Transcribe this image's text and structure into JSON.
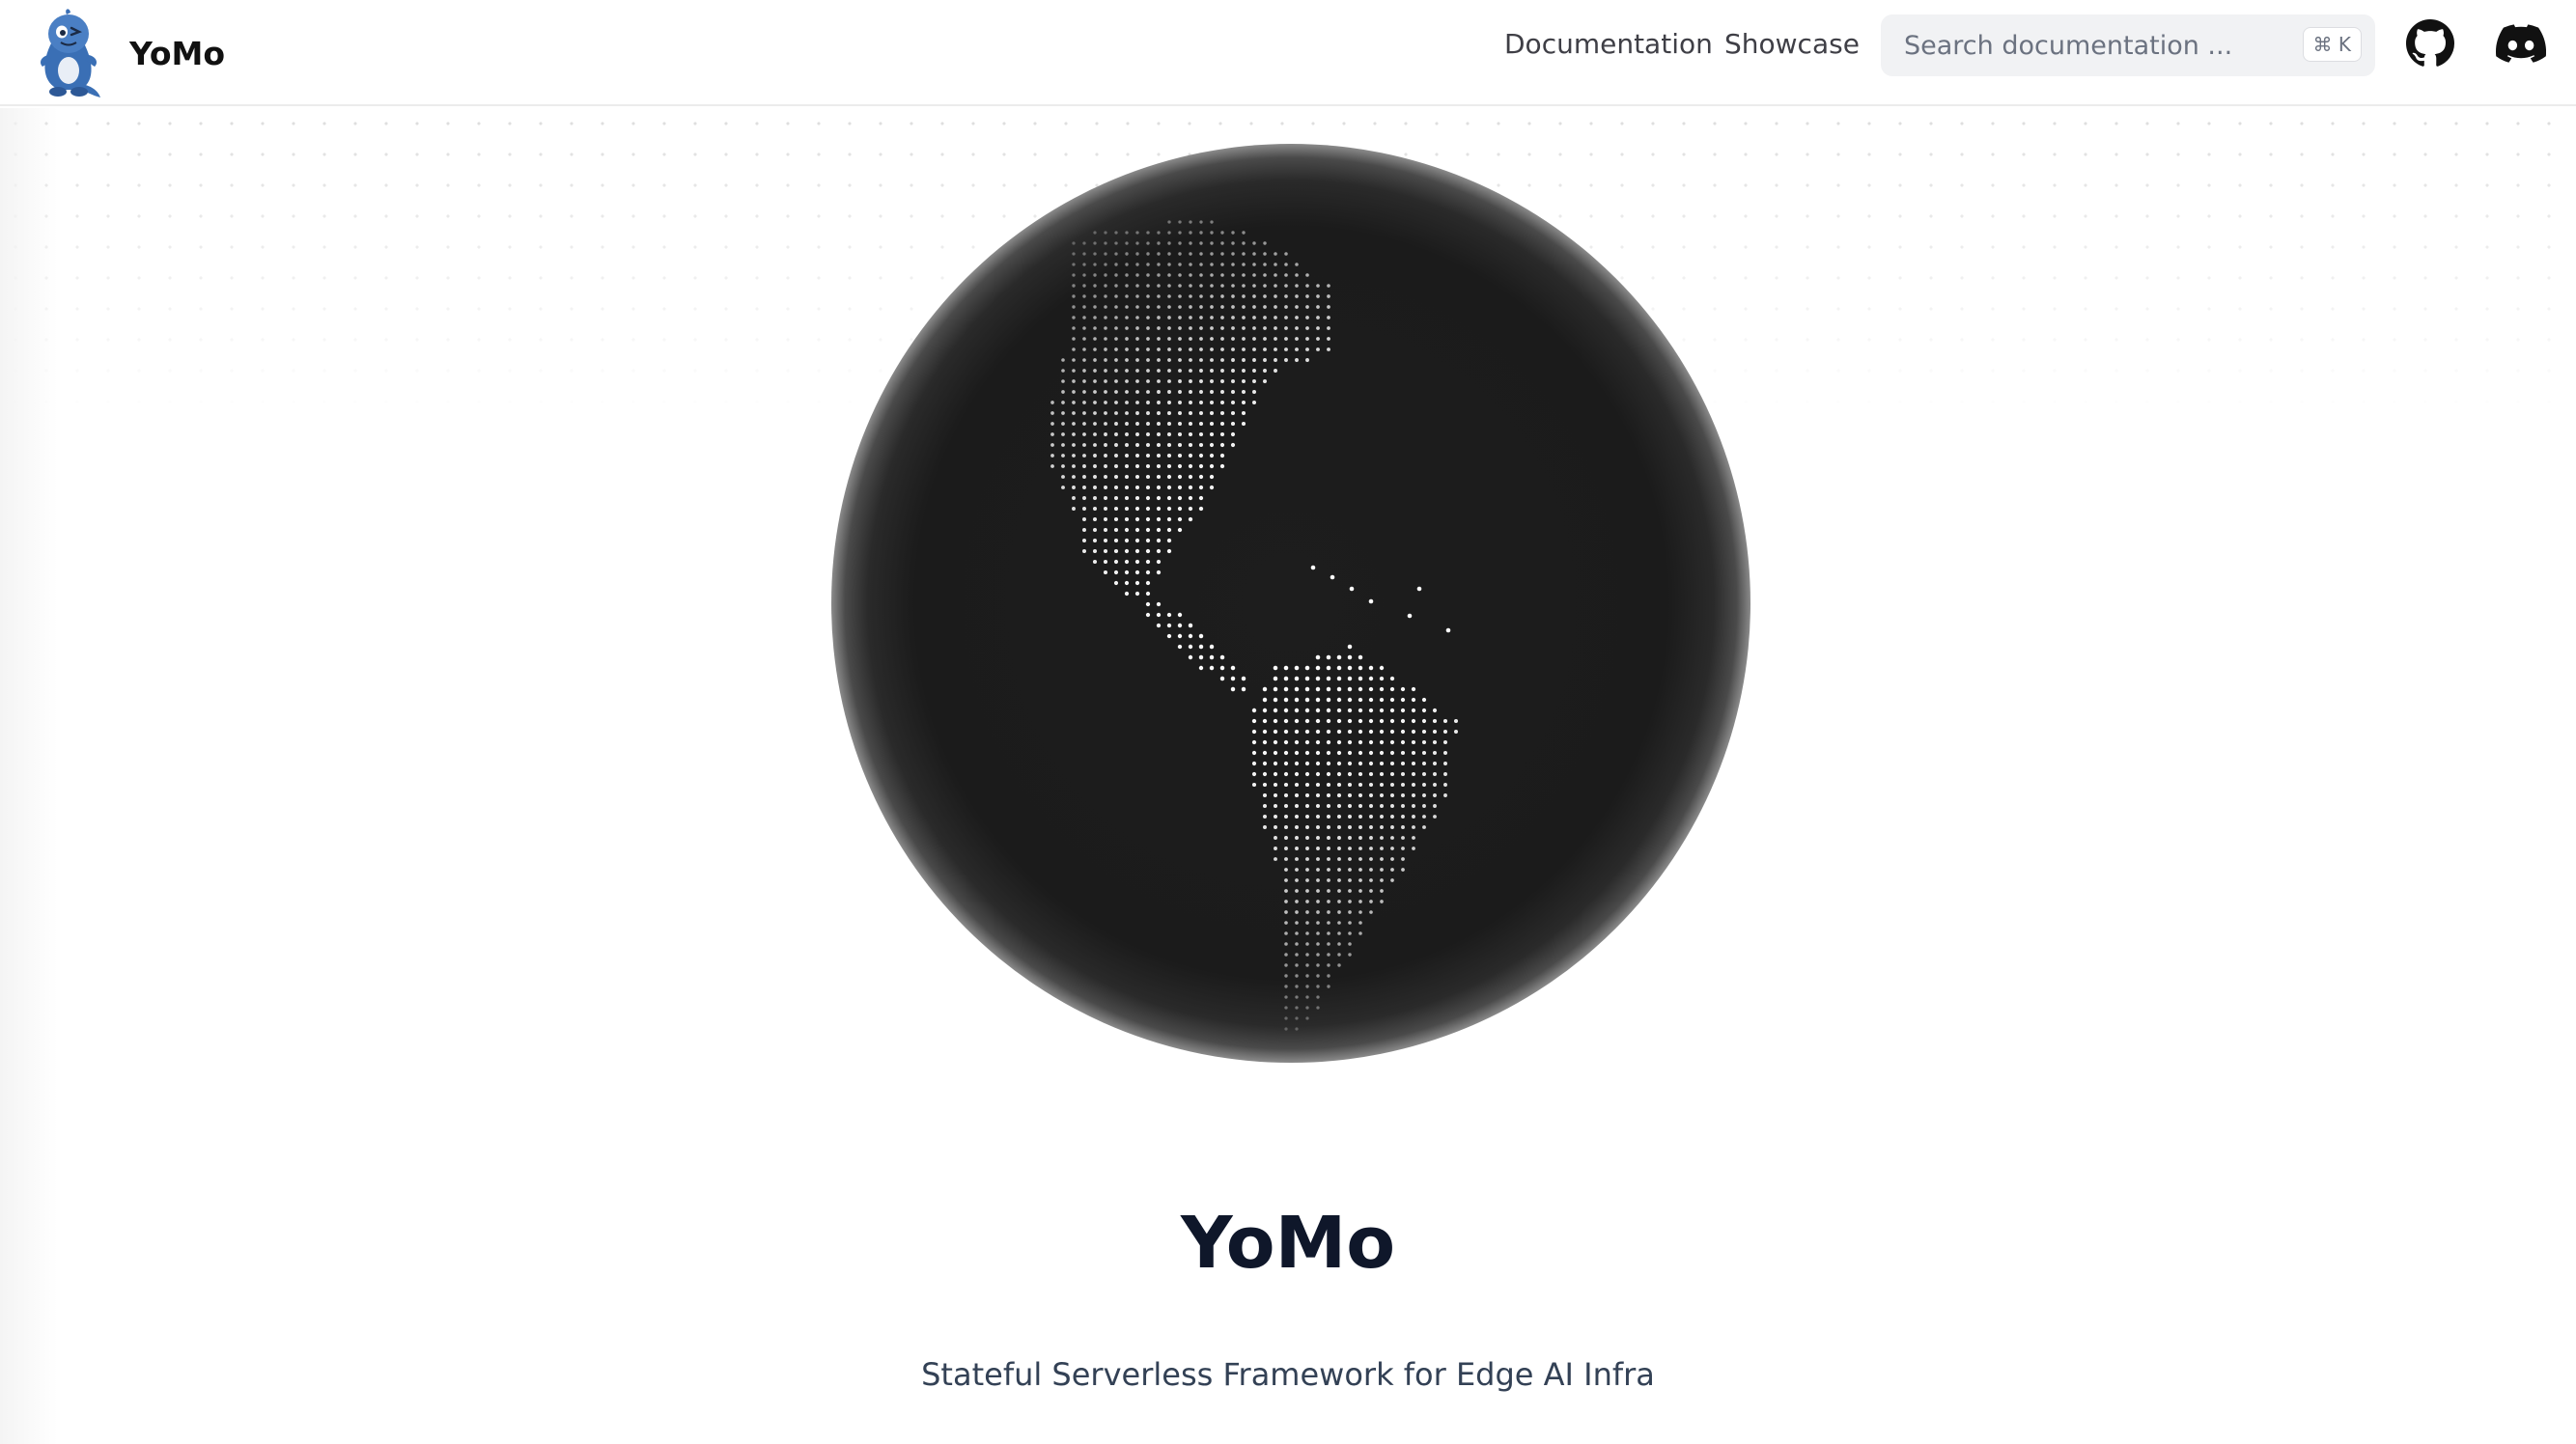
{
  "header": {
    "brand_name": "YoMo",
    "logo_icon": "yomo-mascot-icon",
    "nav": {
      "documentation": "Documentation",
      "showcase": "Showcase"
    },
    "search": {
      "placeholder": "Search documentation ...",
      "shortcut": "⌘ K"
    },
    "social_icons": [
      "github-icon",
      "discord-icon"
    ]
  },
  "hero": {
    "globe_icon": "dotted-globe-americas-icon",
    "title": "YoMo",
    "subtitle": "Stateful Serverless Framework for Edge AI Infra"
  },
  "colors": {
    "globe": "#1c1c1c",
    "title": "#0f172a",
    "text": "#334155",
    "brand_blue": "#3a6fb5"
  }
}
